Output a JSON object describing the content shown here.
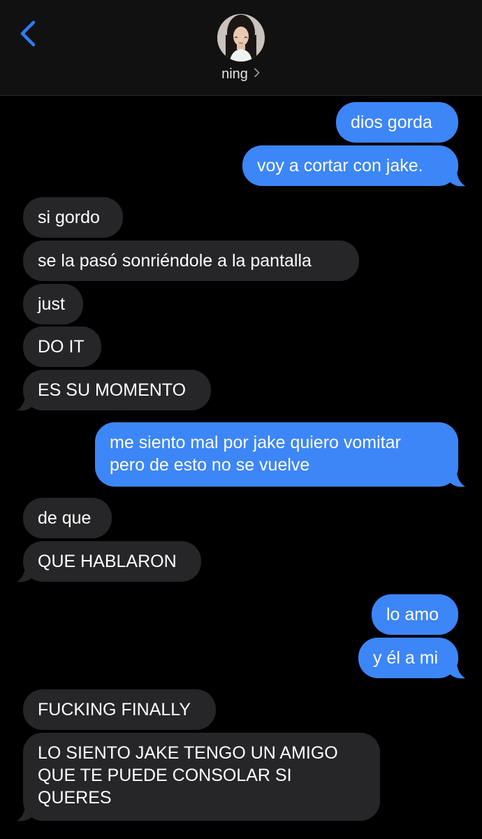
{
  "header": {
    "contact_name": "ning",
    "back_icon": "chevron-left-icon",
    "avatar_icon": "contact-avatar",
    "accent_color": "#2f7cf6"
  },
  "colors": {
    "outgoing_bubble": "#3d86f7",
    "incoming_bubble": "#262628",
    "background": "#000000"
  },
  "messages": [
    {
      "direction": "outgoing",
      "text": "dios gorda"
    },
    {
      "direction": "outgoing",
      "text": "voy a cortar con jake."
    },
    {
      "direction": "incoming",
      "text": "si gordo"
    },
    {
      "direction": "incoming",
      "text": "se la pasó sonriéndole a la pantalla"
    },
    {
      "direction": "incoming",
      "text": "just"
    },
    {
      "direction": "incoming",
      "text": "DO IT"
    },
    {
      "direction": "incoming",
      "text": "ES SU MOMENTO"
    },
    {
      "direction": "outgoing",
      "lines": [
        "me siento mal por jake quiero vomitar",
        "pero de esto no se vuelve"
      ]
    },
    {
      "direction": "incoming",
      "text": "de que"
    },
    {
      "direction": "incoming",
      "text": "QUE HABLARON"
    },
    {
      "direction": "outgoing",
      "text": "lo amo"
    },
    {
      "direction": "outgoing",
      "text": "y él a mi"
    },
    {
      "direction": "incoming",
      "text": "FUCKING FINALLY"
    },
    {
      "direction": "incoming",
      "lines": [
        "LO SIENTO JAKE TENGO UN AMIGO",
        "QUE TE PUEDE CONSOLAR SI",
        "QUERES"
      ]
    }
  ]
}
